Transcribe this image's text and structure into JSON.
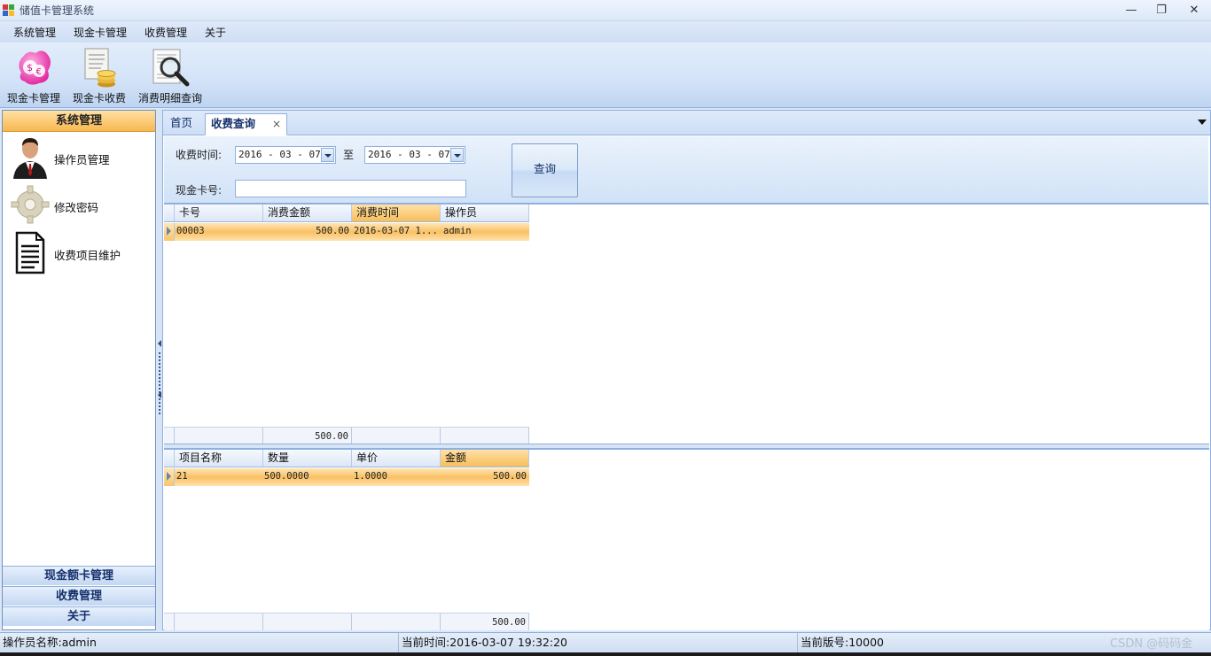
{
  "window": {
    "title": "储值卡管理系统",
    "minimize_glyph": "—",
    "restore_glyph": "❐",
    "close_glyph": "✕"
  },
  "menu": [
    "系统管理",
    "现金卡管理",
    "收费管理",
    "关于"
  ],
  "toolbar": [
    {
      "label": "现金卡管理",
      "icon": "money-coin-icon"
    },
    {
      "label": "现金卡收费",
      "icon": "receipt-coins-icon"
    },
    {
      "label": "消费明细查询",
      "icon": "magnifier-report-icon"
    }
  ],
  "sidebar": {
    "header": "系统管理",
    "items": [
      {
        "label": "操作员管理",
        "icon": "operator-avatar-icon"
      },
      {
        "label": "修改密码",
        "icon": "gear-icon"
      },
      {
        "label": "收费项目维护",
        "icon": "document-icon"
      }
    ],
    "groups": [
      "现金额卡管理",
      "收费管理",
      "关于"
    ]
  },
  "tabs": [
    {
      "label": "首页",
      "active": false
    },
    {
      "label": "收费查询",
      "active": true,
      "close": "×"
    }
  ],
  "query": {
    "time_label": "收费时间:",
    "date_from": "2016 - 03 - 07",
    "to_label": "至",
    "date_to": "2016 - 03 - 07",
    "card_label": "现金卡号:",
    "card_value": "",
    "button": "查询"
  },
  "grid1": {
    "columns": [
      "卡号",
      "消费金额",
      "消费时间",
      "操作员"
    ],
    "rows": [
      [
        "00003",
        "500.00",
        "2016-03-07 1...",
        "admin"
      ]
    ],
    "footer_total": "500.00"
  },
  "grid2": {
    "columns": [
      "项目名称",
      "数量",
      "单价",
      "金额"
    ],
    "rows": [
      [
        "21",
        "500.0000",
        "1.0000",
        "500.00"
      ]
    ],
    "footer_total": "500.00"
  },
  "status": {
    "operator": "操作员名称:admin",
    "time": "当前时间:2016-03-07 19:32:20",
    "version": "当前版号:10000"
  },
  "watermark": "CSDN @码码金",
  "colors": {
    "accent_orange": "#f8b850",
    "frame_blue": "#8fb0de",
    "background": "#dce8f7"
  }
}
